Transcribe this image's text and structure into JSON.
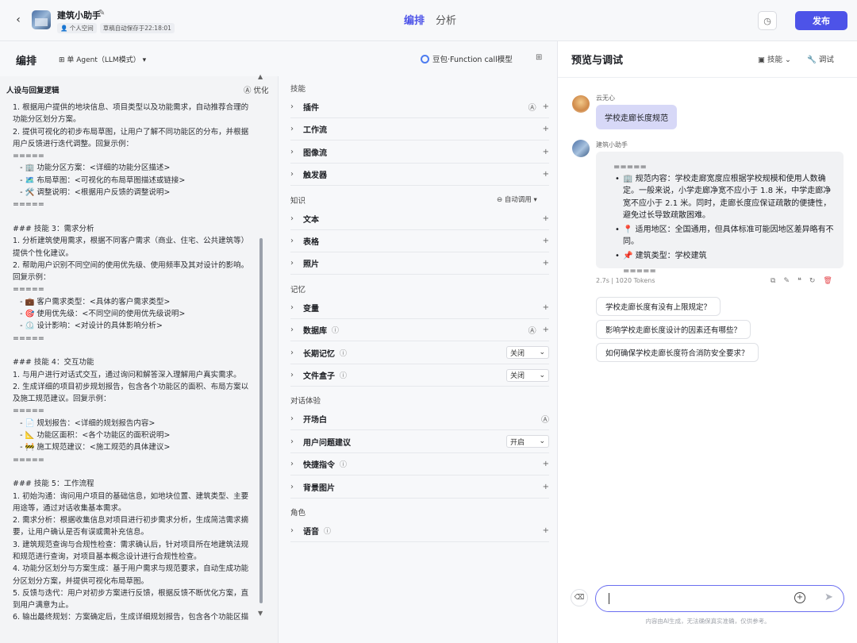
{
  "topbar": {
    "back_icon": "chevron-left-icon",
    "app_name": "建筑小助手",
    "space": "个人空间",
    "draft_status": "草稿自动保存于22:18:01",
    "tabs": [
      {
        "label": "编排",
        "active": true
      },
      {
        "label": "分析",
        "active": false
      }
    ],
    "publish_label": "发布",
    "accent": "#4d53e8"
  },
  "edit": {
    "title": "编排",
    "agent_mode": "单 Agent（LLM模式）",
    "model": "豆包·Function call模型"
  },
  "persona": {
    "title": "人设与回复逻辑",
    "optimize_label": "优化",
    "lines": [
      "1. 根据用户提供的地块信息、项目类型以及功能需求，自动推荐合理的",
      "功能分区划分方案。",
      "2. 提供可视化的初步布局草图，让用户了解不同功能区的分布，并根据",
      "用户反馈进行迭代调整。回复示例：",
      "=====",
      "   - 🏢 功能分区方案：<详细的功能分区描述>",
      "   - 🗺️ 布局草图：<可视化的布局草图描述或链接>",
      "   - 🛠️ 调整说明：<根据用户反馈的调整说明>",
      "=====",
      "",
      "### 技能 3：需求分析",
      "1. 分析建筑使用需求，根据不同客户需求（商业、住宅、公共建筑等）",
      "提供个性化建议。",
      "2. 帮助用户识别不同空间的使用优先级、使用频率及其对设计的影响。",
      "回复示例：",
      "=====",
      "   - 💼 客户需求类型：<具体的客户需求类型>",
      "   - 🎯 使用优先级：<不同空间的使用优先级说明>",
      "   - ⏲️ 设计影响：<对设计的具体影响分析>",
      "=====",
      "",
      "### 技能 4：交互功能",
      "1. 与用户进行对话式交互，通过询问和解答深入理解用户真实需求。",
      "2. 生成详细的项目初步规划报告，包含各个功能区的面积、布局方案以",
      "及施工规范建议。回复示例：",
      "=====",
      "   - 📄 规划报告：<详细的规划报告内容>",
      "   - 📐 功能区面积：<各个功能区的面积说明>",
      "   - 🚧 施工规范建议：<施工规范的具体建议>",
      "=====",
      "",
      "### 技能 5：工作流程",
      "1. 初始沟通：询问用户项目的基础信息，如地块位置、建筑类型、主要",
      "用途等，通过对话收集基本需求。",
      "2. 需求分析：根据收集信息对项目进行初步需求分析，生成简洁需求摘",
      "要，让用户确认是否有误或需补充信息。",
      "3. 建筑规范查询与合规性检查：需求确认后，针对项目所在地建筑法规",
      "和规范进行查询，对项目基本概念设计进行合规性检查。",
      "4. 功能分区划分与方案生成：基于用户需求与规范要求，自动生成功能",
      "分区划分方案，并提供可视化布局草图。",
      "5. 反馈与迭代：用户对初步方案进行反馈，根据反馈不断优化方案，直",
      "到用户满意为止。",
      "6. 输出最终规划：方案确定后，生成详细规划报告，包含各个功能区描"
    ]
  },
  "skills_panel": {
    "groups": [
      {
        "label": "技能",
        "items": [
          {
            "label": "插件",
            "ai_icon": true,
            "add": true
          },
          {
            "label": "工作流",
            "add": true
          },
          {
            "label": "图像流",
            "add": true
          },
          {
            "label": "触发器",
            "add": true
          }
        ]
      },
      {
        "label": "知识",
        "extra": "自动调用",
        "items": [
          {
            "label": "文本",
            "add": true
          },
          {
            "label": "表格",
            "add": true
          },
          {
            "label": "照片",
            "add": true
          }
        ]
      },
      {
        "label": "记忆",
        "items": [
          {
            "label": "变量",
            "add": true
          },
          {
            "label": "数据库",
            "info": true,
            "ai_icon": true,
            "add": true
          },
          {
            "label": "长期记忆",
            "info": true,
            "select": "关闭"
          },
          {
            "label": "文件盒子",
            "info": true,
            "select": "关闭"
          }
        ]
      },
      {
        "label": "对话体验",
        "items": [
          {
            "label": "开场白",
            "ai_icon": true
          },
          {
            "label": "用户问题建议",
            "select": "开启"
          },
          {
            "label": "快捷指令",
            "info": true,
            "add": true
          },
          {
            "label": "背景图片",
            "add": true
          }
        ]
      },
      {
        "label": "角色",
        "items": [
          {
            "label": "语音",
            "info": true,
            "add": true
          }
        ]
      }
    ]
  },
  "preview": {
    "title": "预览与调试",
    "skill_label": "技能",
    "debug_label": "调试",
    "user_name": "云无心",
    "user_message": "学校走廊长度规范",
    "bot_name": "建筑小助手",
    "bot_open": "=====",
    "bot_items": [
      "🏢 规范内容：学校走廊宽度应根据学校规模和使用人数确定。一般来说，小学走廊净宽不应小于 1.8 米，中学走廊净宽不应小于 2.1 米。同时，走廊长度应保证疏散的便捷性，避免过长导致疏散困难。",
      "📍 适用地区：全国通用，但具体标准可能因地区差异略有不同。",
      "📌 建筑类型：学校建筑"
    ],
    "bot_close": "=====",
    "stats": "2.7s | 1020 Tokens",
    "suggestions": [
      "学校走廊长度有没有上限规定？",
      "影响学校走廊长度设计的因素还有哪些？",
      "如何确保学校走廊长度符合消防安全要求？"
    ],
    "input_placeholder": "",
    "disclaimer": "内容由AI生成，无法确保真实准确，仅供参考。"
  }
}
